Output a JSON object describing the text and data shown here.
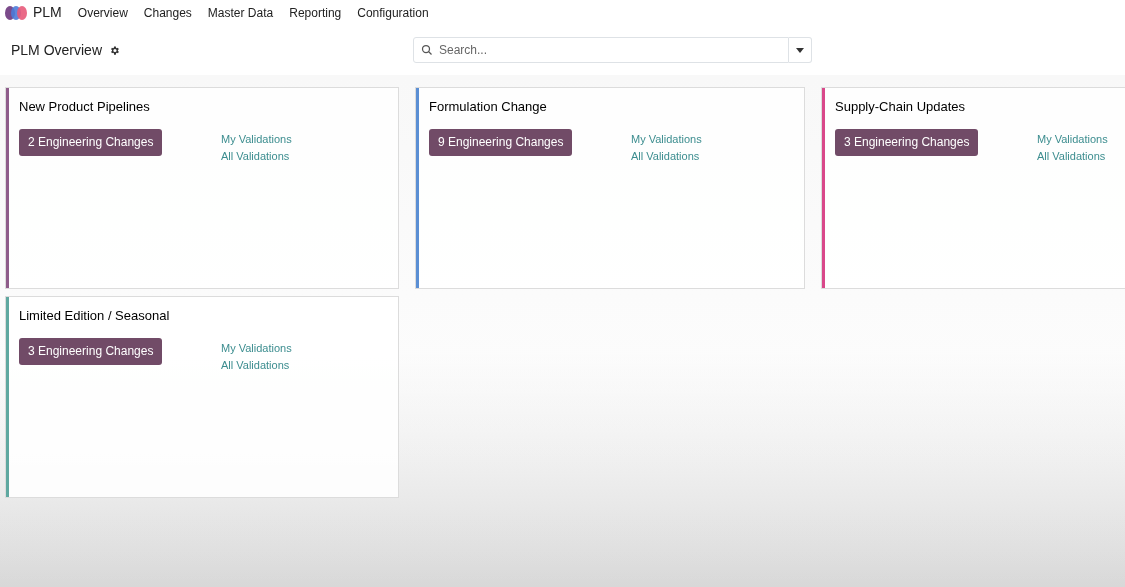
{
  "app": {
    "name": "PLM"
  },
  "menu": [
    "Overview",
    "Changes",
    "Master Data",
    "Reporting",
    "Configuration"
  ],
  "control_panel": {
    "title": "PLM Overview",
    "search": {
      "placeholder": "Search..."
    }
  },
  "cards": [
    {
      "title": "New Product Pipelines",
      "color": "#8e5c8a",
      "button": "2 Engineering Changes",
      "links": [
        "My Validations",
        "All Validations"
      ]
    },
    {
      "title": "Formulation Change",
      "color": "#5b8fd4",
      "button": "9 Engineering Changes",
      "links": [
        "My Validations",
        "All Validations"
      ]
    },
    {
      "title": "Supply-Chain Updates",
      "color": "#d9488a",
      "button": "3 Engineering Changes",
      "links": [
        "My Validations",
        "All Validations"
      ]
    },
    {
      "title": "Limited Edition / Seasonal",
      "color": "#5fa8a0",
      "button": "3 Engineering Changes",
      "links": [
        "My Validations",
        "All Validations"
      ]
    }
  ]
}
